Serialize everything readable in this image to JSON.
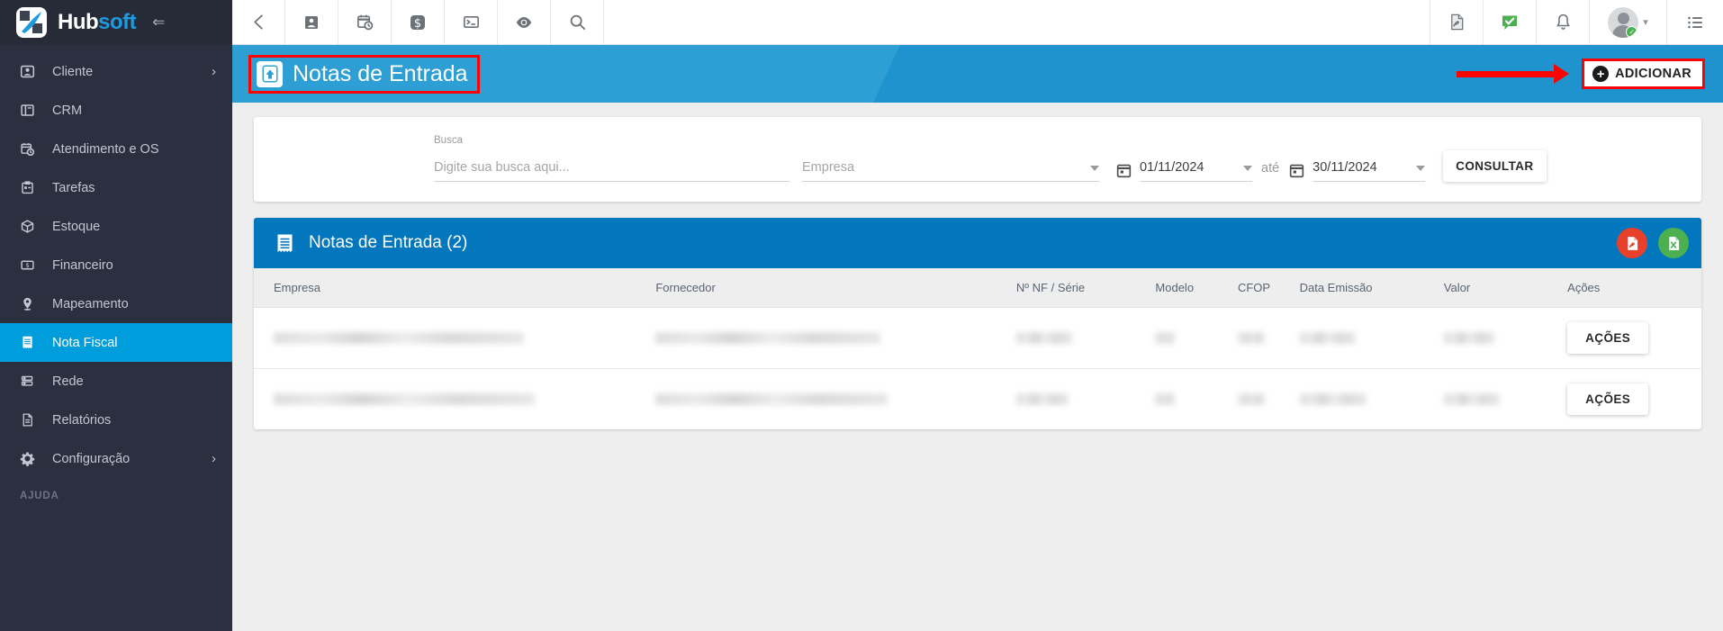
{
  "brand": {
    "name_part1": "Hub",
    "name_part2": "soft",
    "collapse_icon": "collapse-sidebar-icon",
    "accent_color": "#1e9ae0"
  },
  "sidebar": {
    "items": [
      {
        "label": "Cliente",
        "icon": "contact-card-icon",
        "has_chevron": true,
        "active": false
      },
      {
        "label": "CRM",
        "icon": "kanban-board-icon",
        "has_chevron": false,
        "active": false
      },
      {
        "label": "Atendimento e OS",
        "icon": "calendar-clock-icon",
        "has_chevron": false,
        "active": false
      },
      {
        "label": "Tarefas",
        "icon": "tasks-board-icon",
        "has_chevron": false,
        "active": false
      },
      {
        "label": "Estoque",
        "icon": "box-icon",
        "has_chevron": false,
        "active": false
      },
      {
        "label": "Financeiro",
        "icon": "money-bill-icon",
        "has_chevron": false,
        "active": false
      },
      {
        "label": "Mapeamento",
        "icon": "map-pin-icon",
        "has_chevron": false,
        "active": false
      },
      {
        "label": "Nota Fiscal",
        "icon": "receipt-icon",
        "has_chevron": false,
        "active": true
      },
      {
        "label": "Rede",
        "icon": "server-icon",
        "has_chevron": false,
        "active": false
      },
      {
        "label": "Relatórios",
        "icon": "document-icon",
        "has_chevron": false,
        "active": false
      },
      {
        "label": "Configuração",
        "icon": "gear-icon",
        "has_chevron": true,
        "active": false
      }
    ],
    "section_label": "AJUDA",
    "active_color": "#009ddc",
    "background_color": "#2b3040"
  },
  "topbar": {
    "left_icons": [
      "back-arrow-icon",
      "contact-card-icon",
      "calendar-clock-icon",
      "dollar-icon",
      "terminal-icon",
      "eye-icon",
      "search-icon"
    ],
    "right_icons": [
      "pdf-file-icon",
      "chat-check-icon",
      "bell-icon"
    ],
    "avatar": {
      "name": "avatar",
      "status": "online",
      "status_color": "#4caf50",
      "chevron": "chevron-down-icon"
    },
    "menu_icon": "list-menu-icon"
  },
  "page_header": {
    "icon": "upload-note-icon",
    "title": "Notas de Entrada",
    "highlight_color": "#ff0000",
    "background_color": "#2e9fd4",
    "add_button": {
      "label": "ADICIONAR",
      "icon": "plus-circle-icon"
    },
    "annotation": "red-arrow-pointing-to-add-button"
  },
  "filters": {
    "search": {
      "label": "Busca",
      "placeholder": "Digite sua busca aqui...",
      "value": ""
    },
    "company": {
      "label": "Empresa",
      "value": "",
      "icon": "chevron-down-icon"
    },
    "date_from": {
      "value": "01/11/2024",
      "icon": "calendar-icon"
    },
    "date_separator": "até",
    "date_to": {
      "value": "30/11/2024",
      "icon": "calendar-icon"
    },
    "submit_label": "CONSULTAR"
  },
  "table": {
    "title": "Notas de Entrada (2)",
    "title_icon": "receipt-icon",
    "header_color": "#0277bd",
    "export_buttons": [
      {
        "name": "export-pdf-button",
        "icon": "pdf-file-icon",
        "color": "#e8402a"
      },
      {
        "name": "export-excel-button",
        "icon": "excel-file-icon",
        "color": "#4caf50"
      }
    ],
    "columns": [
      "Empresa",
      "Fornecedor",
      "Nº NF / Série",
      "Modelo",
      "CFOP",
      "Data Emissão",
      "Valor",
      "Ações"
    ],
    "row_action_label": "AÇÕES",
    "rows": [
      {
        "empresa": "",
        "fornecedor": "",
        "nf_serie": "",
        "modelo": "",
        "cfop": "",
        "data_emissao": "",
        "valor": "",
        "redacted": true
      },
      {
        "empresa": "",
        "fornecedor": "",
        "nf_serie": "",
        "modelo": "",
        "cfop": "",
        "data_emissao": "",
        "valor": "",
        "redacted": true
      }
    ]
  }
}
